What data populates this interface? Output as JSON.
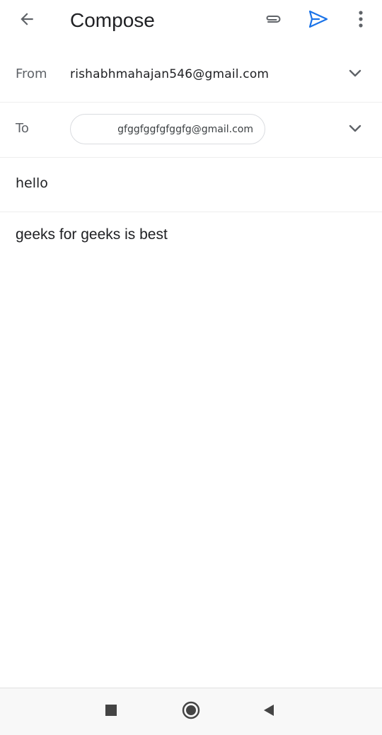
{
  "app_bar": {
    "title": "Compose",
    "icons": {
      "back": "arrow-back-icon",
      "attach": "paperclip-icon",
      "send": "send-icon",
      "more": "more-vert-icon"
    },
    "send_color": "#1a73e8"
  },
  "from": {
    "label": "From",
    "value": "rishabhmahajan546@gmail.com"
  },
  "to": {
    "label": "To",
    "recipient": "gfggfggfgfggfg@gmail.com"
  },
  "subject": {
    "value": "hello"
  },
  "body": {
    "value": "geeks for geeks is best"
  },
  "nav_bar": {
    "icons": [
      "square-icon",
      "circle-icon",
      "triangle-back-icon"
    ]
  }
}
